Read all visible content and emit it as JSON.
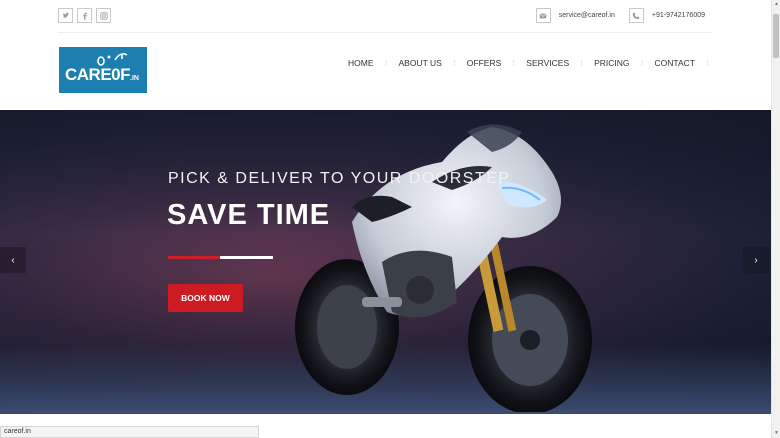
{
  "topbar": {
    "social_icons": [
      "twitter-icon",
      "facebook-icon",
      "instagram-icon"
    ],
    "email": "service@careof.in",
    "phone": "+91-9742176009"
  },
  "logo": {
    "text": "CARE",
    "text2": "0F",
    "suffix": ".IN"
  },
  "nav": {
    "items": [
      "HOME",
      "ABOUT US",
      "OFFERS",
      "SERVICES",
      "PRICING",
      "CONTACT"
    ]
  },
  "hero": {
    "subtitle": "PICK & DELIVER TO YOUR DOORSTEP",
    "title": "SAVE TIME",
    "button": "BOOK NOW",
    "prev_arrow": "‹",
    "next_arrow": "›"
  },
  "status_bar": {
    "url": "careof.in"
  },
  "colors": {
    "brand_blue": "#1d7fb0",
    "accent_red": "#cc1b23"
  }
}
